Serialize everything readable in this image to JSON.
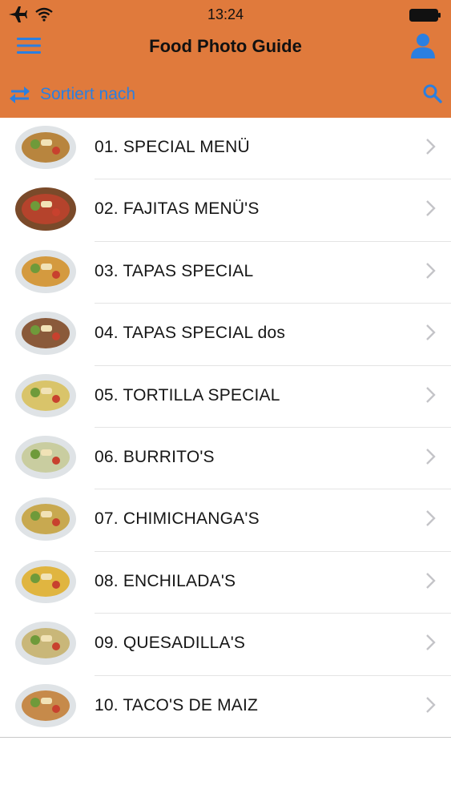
{
  "colors": {
    "header_bg": "#e07a3c",
    "accent": "#2b7fe0",
    "separator": "#e4e4e4",
    "chevron": "#c4c4c8"
  },
  "status_bar": {
    "time": "13:24",
    "icons": [
      "airplane-icon",
      "wifi-icon",
      "battery-icon"
    ]
  },
  "nav": {
    "title": "Food Photo Guide",
    "left_icon": "hamburger-menu-icon",
    "right_icon": "user-icon"
  },
  "sort_bar": {
    "label": "Sortiert nach",
    "icon": "swap-arrows-icon",
    "search_icon": "search-icon"
  },
  "menu": {
    "items": [
      {
        "label": "01. SPECIAL MENÜ",
        "thumb_color": "#b8853e"
      },
      {
        "label": "02. FAJITAS MENÜ'S",
        "thumb_color": "#b5432c"
      },
      {
        "label": "03. TAPAS SPECIAL",
        "thumb_color": "#d49a3f"
      },
      {
        "label": "04. TAPAS SPECIAL dos",
        "thumb_color": "#8a5a3a"
      },
      {
        "label": "05. TORTILLA SPECIAL",
        "thumb_color": "#d9c46a"
      },
      {
        "label": "06. BURRITO'S",
        "thumb_color": "#c9cda0"
      },
      {
        "label": "07. CHIMICHANGA'S",
        "thumb_color": "#c8a950"
      },
      {
        "label": "08. ENCHILADA'S",
        "thumb_color": "#e0b540"
      },
      {
        "label": "09. QUESADILLA'S",
        "thumb_color": "#c9b779"
      },
      {
        "label": "10. TACO'S DE MAIZ",
        "thumb_color": "#c68a4a"
      }
    ]
  }
}
